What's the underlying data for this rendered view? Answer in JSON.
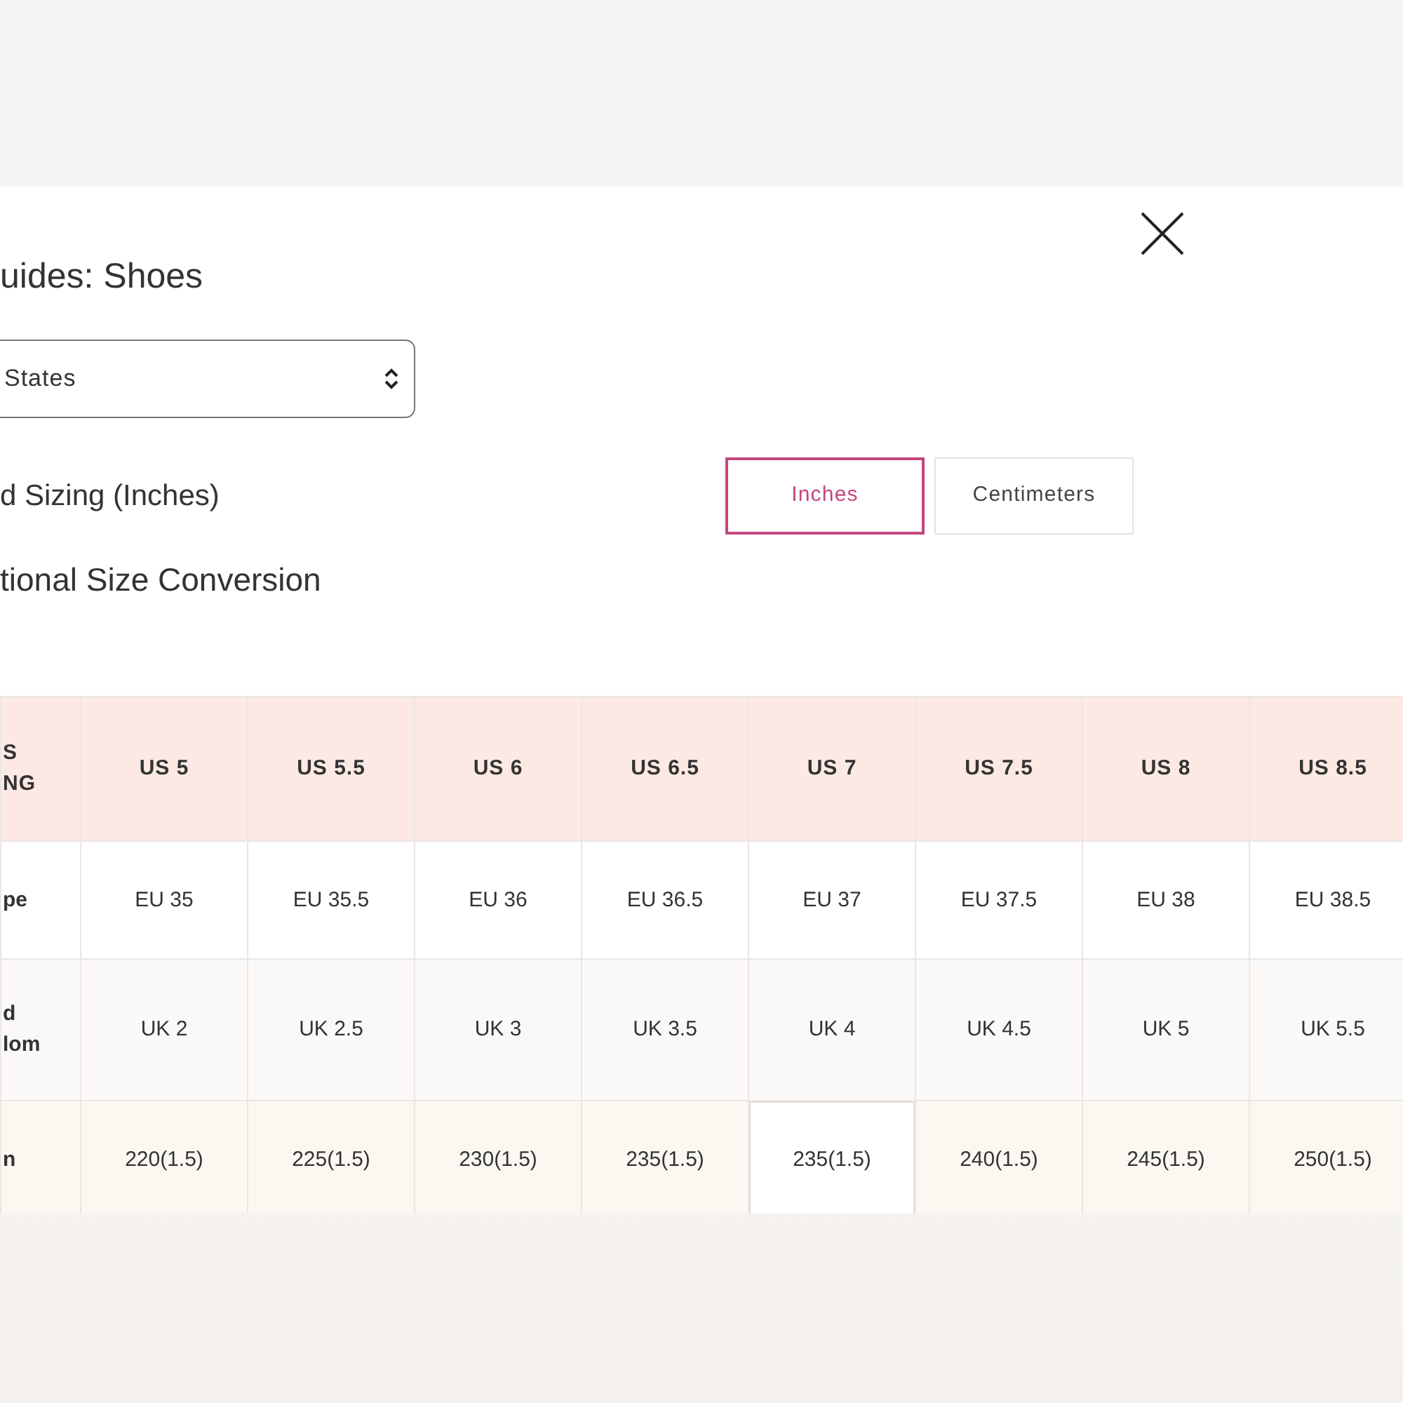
{
  "modal": {
    "title": "uides: Shoes",
    "region_select": {
      "value": "States"
    },
    "section_title": "d Sizing (Inches)",
    "unit_buttons": [
      {
        "label": "Inches",
        "selected": true
      },
      {
        "label": "Centimeters",
        "selected": false
      }
    ],
    "subtitle": "tional Size Conversion"
  },
  "table": {
    "header": [
      "S\nNG",
      "US 5",
      "US 5.5",
      "US 6",
      "US 6.5",
      "US 7",
      "US 7.5",
      "US 8",
      "US 8.5"
    ],
    "rows": [
      {
        "cells": [
          {
            "text": "pe",
            "highlighted": false
          },
          {
            "text": "EU 35",
            "highlighted": false
          },
          {
            "text": "EU 35.5",
            "highlighted": false
          },
          {
            "text": "EU 36",
            "highlighted": false
          },
          {
            "text": "EU 36.5",
            "highlighted": false
          },
          {
            "text": "EU 37",
            "highlighted": false
          },
          {
            "text": "EU 37.5",
            "highlighted": false
          },
          {
            "text": "EU 38",
            "highlighted": false
          },
          {
            "text": "EU 38.5",
            "highlighted": false
          }
        ]
      },
      {
        "cells": [
          {
            "text": "d\nlom",
            "highlighted": false
          },
          {
            "text": "UK 2",
            "highlighted": false
          },
          {
            "text": "UK 2.5",
            "highlighted": false
          },
          {
            "text": "UK 3",
            "highlighted": false
          },
          {
            "text": "UK 3.5",
            "highlighted": false
          },
          {
            "text": "UK 4",
            "highlighted": false
          },
          {
            "text": "UK 4.5",
            "highlighted": false
          },
          {
            "text": "UK 5",
            "highlighted": false
          },
          {
            "text": "UK 5.5",
            "highlighted": false
          }
        ]
      },
      {
        "cells": [
          {
            "text": "n",
            "highlighted": false
          },
          {
            "text": "220(1.5)",
            "highlighted": false
          },
          {
            "text": "225(1.5)",
            "highlighted": false
          },
          {
            "text": "230(1.5)",
            "highlighted": false
          },
          {
            "text": "235(1.5)",
            "highlighted": false
          },
          {
            "text": "235(1.5)",
            "highlighted": true
          },
          {
            "text": "240(1.5)",
            "highlighted": false
          },
          {
            "text": "245(1.5)",
            "highlighted": false
          },
          {
            "text": "250(1.5)",
            "highlighted": false
          }
        ]
      }
    ]
  }
}
